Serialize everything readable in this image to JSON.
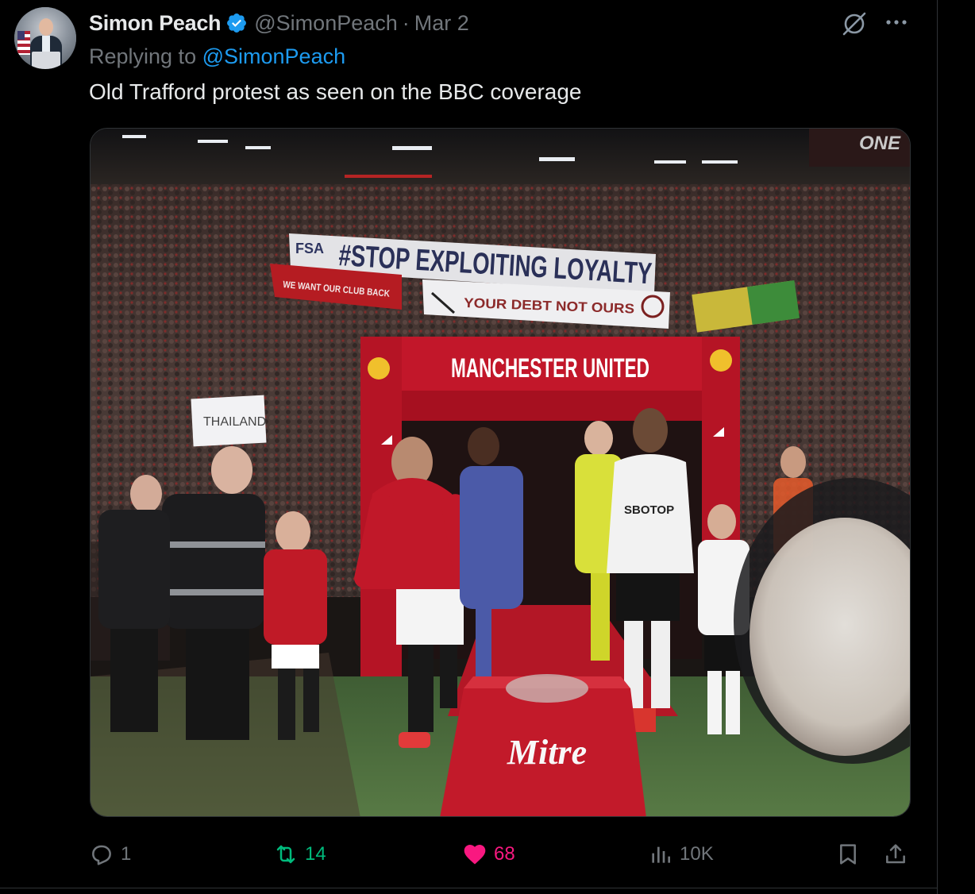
{
  "tweet": {
    "author_name": "Simon Peach",
    "author_handle": "@SimonPeach",
    "date_separator": "·",
    "date": "Mar 2",
    "reply_prefix": "Replying to",
    "reply_to": "@SimonPeach",
    "text": "Old Trafford protest as seen on the BBC coverage"
  },
  "media": {
    "banners": {
      "stop_exploiting": "#STOP EXPLOITING LOYALTY",
      "fsa": "FSA",
      "debt": "YOUR DEBT NOT OURS",
      "we_want": "WE WANT OUR CLUB BACK",
      "tunnel": "MANCHESTER UNITED",
      "thailand": "THAILAND",
      "mitre": "Mitre",
      "sponsor": "SBOTOP",
      "one": "ONE"
    }
  },
  "actions": {
    "replies": "1",
    "retweets": "14",
    "likes": "68",
    "views": "10K"
  },
  "colors": {
    "accent": "#1d9bf0",
    "retweet": "#00ba7c",
    "like": "#f91880",
    "muted": "#71767b",
    "united_red": "#c8102e"
  },
  "icons": [
    "verified-badge-icon",
    "grok-icon",
    "more-icon",
    "reply-icon",
    "retweet-icon",
    "like-icon",
    "views-icon",
    "bookmark-icon",
    "share-icon"
  ]
}
